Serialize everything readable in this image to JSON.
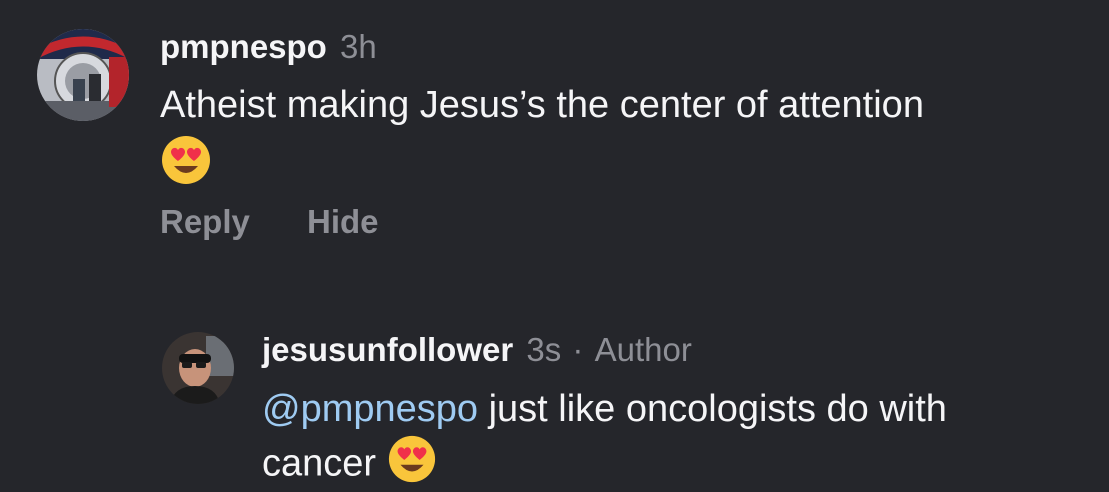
{
  "comment": {
    "username": "pmpnespo",
    "time": "3h",
    "text": "Atheist making Jesus’s the center of attention",
    "emoji": "heart-eyes-emoji",
    "actions": {
      "reply": "Reply",
      "hide": "Hide"
    }
  },
  "reply": {
    "username": "jesusunfollower",
    "time": "3s",
    "separator": "·",
    "badge": "Author",
    "mention": "@pmpnespo",
    "text_line1": " just like oncologists do with",
    "text_line2": "cancer ",
    "emoji": "heart-eyes-emoji"
  },
  "colors": {
    "background": "#25262b",
    "text": "#f5f5f7",
    "muted": "#8e8f96",
    "mention": "#9fcbf2",
    "emoji_face": "#f9c53b",
    "emoji_heart": "#f0304a"
  }
}
